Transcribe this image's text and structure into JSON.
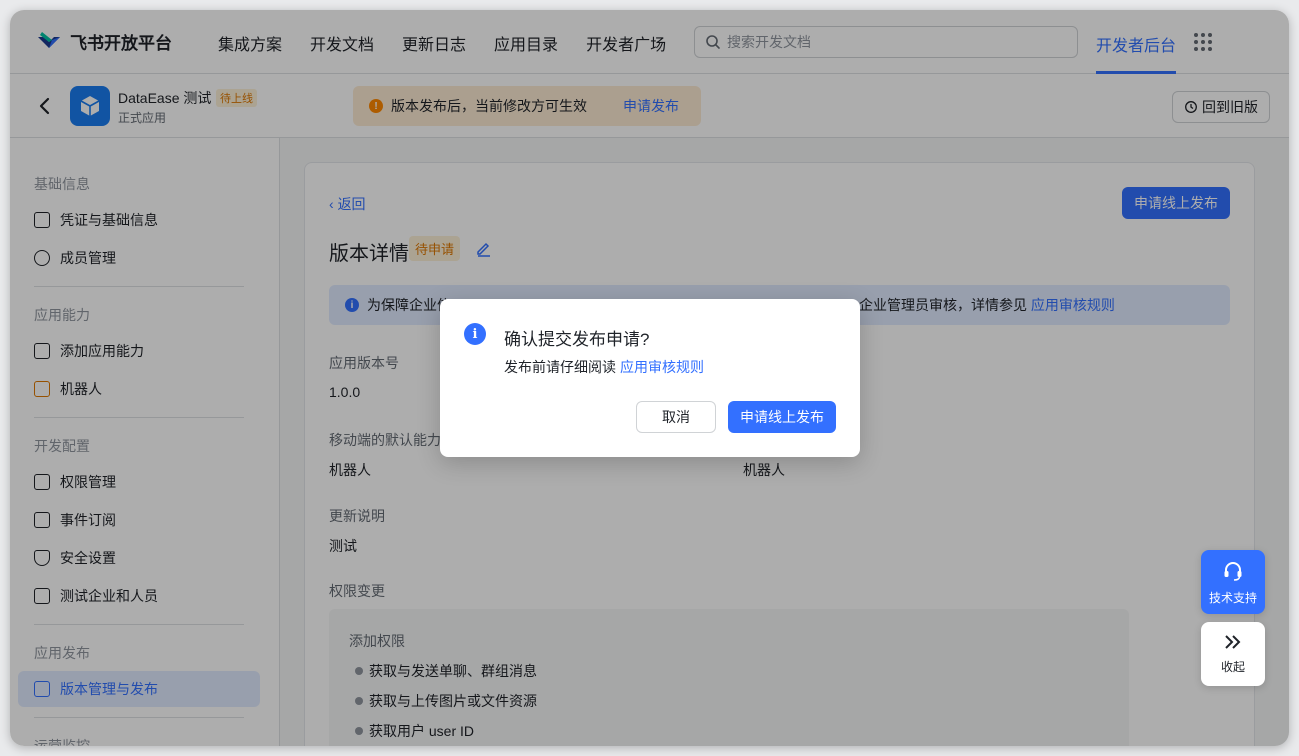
{
  "brand": {
    "name": "飞书开放平台"
  },
  "nav": {
    "items": [
      {
        "label": "集成方案"
      },
      {
        "label": "开发文档"
      },
      {
        "label": "更新日志"
      },
      {
        "label": "应用目录"
      },
      {
        "label": "开发者广场"
      }
    ],
    "search_placeholder": "搜索开发文档",
    "console_label": "开发者后台"
  },
  "app": {
    "name": "DataEase 测试",
    "status": "待上线",
    "type": "正式应用"
  },
  "notice": {
    "text": "版本发布后，当前修改方可生效",
    "link": "申请发布"
  },
  "revert_label": "回到旧版",
  "sidebar": {
    "sections": [
      {
        "title": "基础信息",
        "items": [
          {
            "label": "凭证与基础信息"
          },
          {
            "label": "成员管理"
          }
        ]
      },
      {
        "title": "应用能力",
        "items": [
          {
            "label": "添加应用能力"
          },
          {
            "label": "机器人"
          }
        ]
      },
      {
        "title": "开发配置",
        "items": [
          {
            "label": "权限管理"
          },
          {
            "label": "事件订阅"
          },
          {
            "label": "安全设置"
          },
          {
            "label": "测试企业和人员"
          }
        ]
      },
      {
        "title": "应用发布",
        "items": [
          {
            "label": "版本管理与发布"
          }
        ]
      },
      {
        "title": "运营监控",
        "items": []
      }
    ]
  },
  "content": {
    "back": "返回",
    "publish_button": "申请线上发布",
    "title": "版本详情",
    "title_tag": "待申请",
    "banner": {
      "prefix": "为保障企业信",
      "middle": "企业管理员审核，详情参见",
      "link": "应用审核规则"
    },
    "fields": {
      "version_label": "应用版本号",
      "version_value": "1.0.0",
      "mobile_label": "移动端的默认能力",
      "mobile_value": "机器人",
      "desktop_value": "机器人",
      "notes_label": "更新说明",
      "notes_value": "测试",
      "perm_label": "权限变更"
    },
    "permissions": {
      "subtitle": "添加权限",
      "items": [
        "获取与发送单聊、群组消息",
        "获取与上传图片或文件资源",
        "获取用户 user ID"
      ]
    }
  },
  "modal": {
    "title": "确认提交发布申请?",
    "desc": "发布前请仔细阅读",
    "desc_link": "应用审核规则",
    "cancel": "取消",
    "confirm": "申请线上发布"
  },
  "float": {
    "support": "技术支持",
    "collapse": "收起"
  },
  "colors": {
    "accent": "#3370ff",
    "warning": "#ff8800",
    "status_text": "#de7802"
  }
}
